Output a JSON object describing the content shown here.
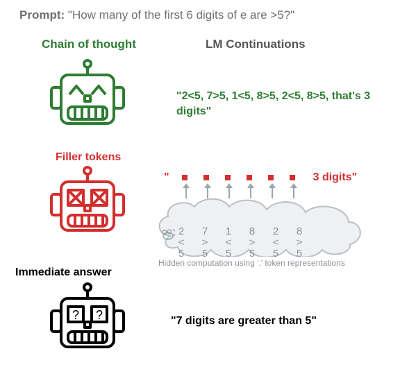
{
  "prompt": {
    "label": "Prompt:",
    "text": "\"How many of the first 6 digits of e are >5?\""
  },
  "columns": {
    "left": "Chain of thought",
    "right": "LM Continuations"
  },
  "sections": {
    "filler": "Filler tokens",
    "immediate": "Immediate answer"
  },
  "cot_continuation": "\"2<5,  7>5,  1<5,  8>5,  2<5,  8>5, that's 3 digits\"",
  "filler": {
    "open_quote": "\"",
    "dots": [
      ".",
      ".",
      ".",
      ".",
      ".",
      "."
    ],
    "answer": "3 digits\"",
    "cloud_cols": [
      {
        "d": "2",
        "op": "<",
        "c": "5"
      },
      {
        "d": "7",
        "op": ">",
        "c": "5"
      },
      {
        "d": "1",
        "op": "<",
        "c": "5"
      },
      {
        "d": "8",
        "op": ">",
        "c": "5"
      },
      {
        "d": "2",
        "op": "<",
        "c": "5"
      },
      {
        "d": "8",
        "op": ">",
        "c": "5"
      }
    ],
    "cloud_caption": "Hidden computation using '.' token representations"
  },
  "immediate_continuation": "\"7 digits are greater than 5\"",
  "colors": {
    "green": "#2e7d32",
    "red": "#d32f2f",
    "gray": "#8a9299",
    "black": "#000000"
  }
}
